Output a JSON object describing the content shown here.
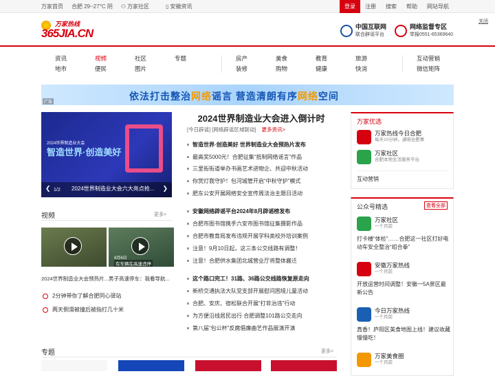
{
  "topbar": {
    "home": "万家首页",
    "weather": "合肥 29~27°C 阴",
    "community": "万家社区",
    "anhui": "安徽资讯",
    "login": "登录",
    "register": "注册",
    "search": "搜索",
    "help": "帮助",
    "sitenav": "网站导航"
  },
  "header": {
    "logo_top": "万家热线",
    "logo_main": "365JIA.CN",
    "partner1_title": "中国互联网",
    "partner1_sub": "联合辟谣平台",
    "partner2_title": "网络监督专区",
    "partner2_sub": "举报0551-65369640",
    "close": "关闭"
  },
  "nav": {
    "col1": [
      "资讯",
      "地市"
    ],
    "col2": [
      "视频",
      "便民"
    ],
    "col3": [
      "社区",
      "图片"
    ],
    "col4": [
      "专题"
    ],
    "col5": [
      "房产",
      "装修"
    ],
    "col6": [
      "美食",
      "购物"
    ],
    "col7": [
      "教育",
      "健康"
    ],
    "col8": [
      "旅游",
      "快消"
    ],
    "col9": [
      "互动营销",
      "微信矩阵"
    ]
  },
  "banner": {
    "text_a": "依法打击整治",
    "text_b": "网络",
    "text_c": "谣言  营造清朗有序",
    "text_d": "网络",
    "text_e": "空间",
    "tag": "广告"
  },
  "slide": {
    "line1": "2024世界制造业大会",
    "line2": "智造世界·创造美好",
    "page": "1/2",
    "caption": "2024世界制造业大会六大亮点抢..."
  },
  "video": {
    "title": "视频",
    "more": "更多>",
    "items": [
      {
        "caption": "2024世界制造业大会预热片..."
      },
      {
        "caption": "男子高速停车：我看导航..."
      }
    ],
    "overlay": "有车辆在高速违停",
    "date": "8月6日"
  },
  "bullets": [
    "2分钟带你了解合肥同心驿站",
    "两天侧滑被撞后被指打几十米"
  ],
  "zhuanti": {
    "title": "专题",
    "more": "更多>"
  },
  "headline": {
    "title": "2024世界制造业大会进入倒计时",
    "sub1": "[今日辟谣]",
    "sub2": "[网络辟谣区域联动]",
    "more": "更多资讯>"
  },
  "news": [
    {
      "text": "智造世界·创造美好 世界制造业大会预热片发布",
      "bold": true
    },
    {
      "text": "最高奖5000元！合肥征集“抵制网络谣言”作品",
      "bold": false
    },
    {
      "text": "三里街街道举办书画艺术进物企、共迎中秋活动",
      "bold": false
    },
    {
      "text": "你赏灯我守护！包河城管开启“中秋守护”模式",
      "bold": false
    },
    {
      "text": "肥东公安开展网络安全宣传周法治主题日活动",
      "bold": false
    },
    {
      "text": "安徽网络辟谣平台2024年8月辟谣榜发布",
      "bold": true
    },
    {
      "text": "合肥市图书馆携手六安市图书馆征集摄影作品",
      "bold": false
    },
    {
      "text": "合肥市教育局发布违规开展学科类校外培训案例",
      "bold": false
    },
    {
      "text": "注意！9月10日起，这三条公交线路有调整！",
      "bold": false
    },
    {
      "text": "注意！合肥供水集团北城营业厅将整体搬迁",
      "bold": false
    },
    {
      "text": "这个路口完工！31路、36路公交线路恢复原走向",
      "bold": true
    },
    {
      "text": "新桥交通执法大队党支部开展慰问困境儿童活动",
      "bold": false
    },
    {
      "text": "合肥、安庆、宿松联合开展“打非治违”行动",
      "bold": false
    },
    {
      "text": "为方便沿线居民出行 合肥调整101路公交走向",
      "bold": false
    },
    {
      "text": "第八届“包公杯”反腐倡廉曲艺作品展演开演",
      "bold": false
    }
  ],
  "right": {
    "youxuan_title": "万家优选",
    "items": [
      {
        "name": "万家热线今日合肥",
        "sub": "每天10分钟，通晓合肥事",
        "color": "#d7000f"
      },
      {
        "name": "万家社区",
        "sub": "合肥本地生活服务平台",
        "color": "#2aa34a"
      }
    ],
    "interactive": "互动营销",
    "gzh_title": "公众号精选",
    "viewall": "查看全部",
    "accounts": [
      {
        "name": "万家社区",
        "time": "一个月前",
        "desc": "打卡楼“体检”……合肥这一社区打好电动车安全整治“组合拳”",
        "color": "#2aa34a"
      },
      {
        "name": "安徽万家热线",
        "time": "一个月前",
        "desc": "开放运营时间调整！安徽一5A景区最新公告",
        "color": "#d7000f"
      },
      {
        "name": "今日万家热线",
        "time": "一个月前",
        "desc": "真香！庐阳区美食地图上线！建议收藏慢慢吃！",
        "color": "#1a5fb4"
      },
      {
        "name": "万家美食圈",
        "time": "一个月前",
        "desc": "",
        "color": "#f39800"
      }
    ]
  }
}
